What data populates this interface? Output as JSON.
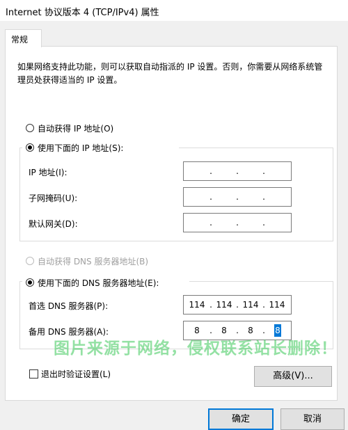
{
  "window": {
    "title": "Internet 协议版本 4 (TCP/IPv4) 属性"
  },
  "tab": {
    "label": "常规"
  },
  "description": "如果网络支持此功能，则可以获取自动指派的 IP 设置。否则，你需要从网络系统管理员处获得适当的 IP 设置。",
  "ip": {
    "auto_label": "自动获得 IP 地址(O)",
    "manual_label": "使用下面的 IP 地址(S):",
    "address_label": "IP 地址(I):",
    "subnet_label": "子网掩码(U):",
    "gateway_label": "默认网关(D):",
    "dot": "."
  },
  "dns": {
    "auto_label": "自动获得 DNS 服务器地址(B)",
    "manual_label": "使用下面的 DNS 服务器地址(E):",
    "preferred_label": "首选 DNS 服务器(P):",
    "preferred_value": [
      "114",
      "114",
      "114",
      "114"
    ],
    "alternate_label": "备用 DNS 服务器(A):",
    "alternate_value": [
      "8",
      "8",
      "8",
      "8"
    ]
  },
  "validate_label": "退出时验证设置(L)",
  "buttons": {
    "advanced": "高级(V)...",
    "ok": "确定",
    "cancel": "取消"
  },
  "watermark": "图片来源于网络，侵权联系站长删除！",
  "colors": {
    "accent": "#0078d7",
    "watermark": "#3cc85a"
  }
}
